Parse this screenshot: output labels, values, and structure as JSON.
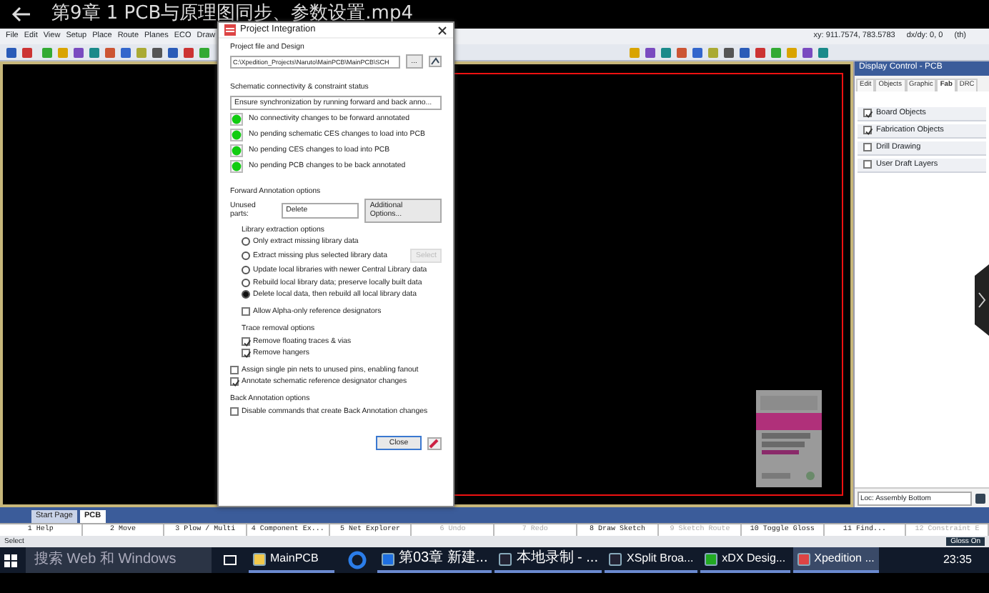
{
  "video_title": "第9章 1 PCB与原理图同步、参数设置.mp4",
  "app": {
    "menu": [
      "File",
      "Edit",
      "View",
      "Setup",
      "Place",
      "Route",
      "Planes",
      "ECO",
      "Draw"
    ],
    "coordinates": "xy: 911.7574, 783.5783",
    "delta": "dx/dy: 0, 0",
    "units": "(th)"
  },
  "dialog": {
    "title": "Project Integration",
    "project_label": "Project file and Design",
    "project_path": "C:\\Xpedition_Projects\\Naruto\\MainPCB\\MainPCB\\SCH",
    "browse_button": "...",
    "status_label": "Schematic connectivity & constraint status",
    "status_message": "Ensure synchronization by running forward and back anno...",
    "status_items": [
      {
        "text": "No connectivity changes to be forward annotated"
      },
      {
        "text": "No pending schematic CES changes to load into PCB"
      },
      {
        "text": "No pending CES changes to load into PCB"
      },
      {
        "text": "No pending PCB changes to be back annotated"
      }
    ],
    "forward_label": "Forward Annotation options",
    "unused_parts_label": "Unused parts:",
    "unused_parts_value": "Delete",
    "additional_button": "Additional Options...",
    "library_label": "Library extraction options",
    "library_options": [
      {
        "text": "Only extract missing library data",
        "selected": false
      },
      {
        "text": "Extract missing plus selected library data",
        "selected": false,
        "button": "Select"
      },
      {
        "text": "Update local libraries with newer Central Library data",
        "selected": false
      },
      {
        "text": "Rebuild local library data; preserve locally built data",
        "selected": false
      },
      {
        "text": "Delete local data, then rebuild all local library data",
        "selected": true
      }
    ],
    "alpha_option": {
      "text": "Allow Alpha-only reference designators",
      "checked": false
    },
    "trace_label": "Trace removal options",
    "trace_options": [
      {
        "text": "Remove floating traces & vias",
        "checked": true
      },
      {
        "text": "Remove hangers",
        "checked": true
      }
    ],
    "other_options": [
      {
        "text": "Assign single pin nets to unused pins, enabling fanout",
        "checked": false
      },
      {
        "text": "Annotate schematic reference designator changes",
        "checked": true
      }
    ],
    "back_label": "Back Annotation options",
    "back_options": [
      {
        "text": "Disable commands that create Back Annotation changes",
        "checked": false
      }
    ],
    "close_button": "Close"
  },
  "display_control": {
    "title": "Display Control - PCB",
    "tabs": [
      {
        "label": "Edit",
        "selected": false
      },
      {
        "label": "Objects",
        "selected": false
      },
      {
        "label": "Graphic",
        "selected": false
      },
      {
        "label": "Fab",
        "selected": true
      },
      {
        "label": "DRC",
        "selected": false
      }
    ],
    "items": [
      {
        "label": "Board Objects",
        "checked": true
      },
      {
        "label": "Fabrication Objects",
        "checked": true
      },
      {
        "label": "Drill Drawing",
        "checked": false
      },
      {
        "label": "User Draft Layers",
        "checked": false
      }
    ],
    "location": "Loc: Assembly Bottom"
  },
  "document_tabs": [
    {
      "label": "Start Page",
      "selected": false
    },
    {
      "label": "PCB",
      "selected": true
    }
  ],
  "function_keys": [
    {
      "label": "1 Help",
      "disabled": false
    },
    {
      "label": "2 Move",
      "disabled": false
    },
    {
      "label": "3 Plow / Multi",
      "disabled": false
    },
    {
      "label": "4 Component Ex...",
      "disabled": false
    },
    {
      "label": "5 Net Explorer",
      "disabled": false
    },
    {
      "label": "6 Undo",
      "disabled": true
    },
    {
      "label": "7 Redo",
      "disabled": true
    },
    {
      "label": "8 Draw Sketch",
      "disabled": false
    },
    {
      "label": "9 Sketch Route",
      "disabled": true
    },
    {
      "label": "10 Toggle Gloss",
      "disabled": false
    },
    {
      "label": "11 Find...",
      "disabled": false
    },
    {
      "label": "12 Constraint E",
      "disabled": true
    }
  ],
  "status_bar": {
    "mode": "Select",
    "gloss": "Gloss On"
  },
  "taskbar": {
    "search_placeholder": "搜索 Web 和 Windows",
    "items": [
      {
        "label": "MainPCB",
        "kind": "folder"
      },
      {
        "label": "第03章 新建...",
        "kind": "note"
      },
      {
        "label": "本地录制 - ...",
        "kind": "screen"
      },
      {
        "label": "XSplit Broa...",
        "kind": "screen"
      },
      {
        "label": "xDX Desig...",
        "kind": "designer"
      },
      {
        "label": "Xpedition ...",
        "kind": "xpedition",
        "selected": true
      }
    ],
    "time": "23:35"
  }
}
